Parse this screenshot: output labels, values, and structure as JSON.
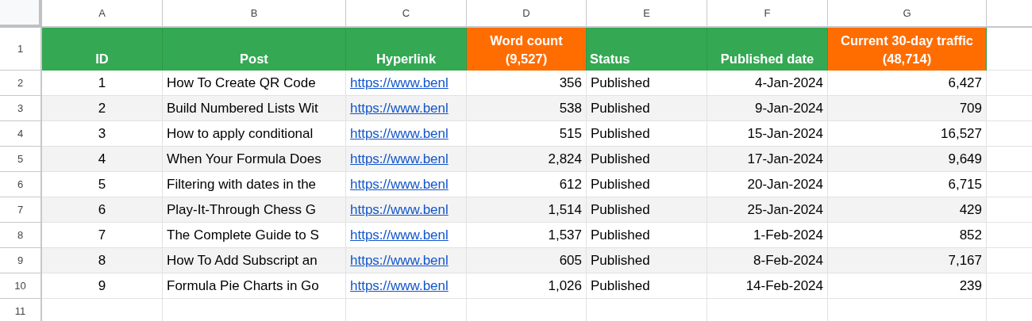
{
  "column_letters": [
    "A",
    "B",
    "C",
    "D",
    "E",
    "F",
    "G"
  ],
  "row_numbers": [
    "1",
    "2",
    "3",
    "4",
    "5",
    "6",
    "7",
    "8",
    "9",
    "10",
    "11"
  ],
  "header": [
    {
      "label": "ID",
      "color": "#34a853"
    },
    {
      "label": "Post",
      "color": "#34a853"
    },
    {
      "label": "Hyperlink",
      "color": "#34a853"
    },
    {
      "label": "Word count (9,527)",
      "color": "#ff6d01"
    },
    {
      "label": "Status",
      "color": "#34a853"
    },
    {
      "label": "Published date",
      "color": "#34a853"
    },
    {
      "label": "Current 30-day traffic (48,714)",
      "color": "#ff6d01"
    }
  ],
  "rows": [
    [
      "1",
      "How To Create QR Code",
      "https://www.benl",
      "356",
      "Published",
      "4-Jan-2024",
      "6,427"
    ],
    [
      "2",
      "Build Numbered Lists Wit",
      "https://www.benl",
      "538",
      "Published",
      "9-Jan-2024",
      "709"
    ],
    [
      "3",
      "How to apply conditional",
      "https://www.benl",
      "515",
      "Published",
      "15-Jan-2024",
      "16,527"
    ],
    [
      "4",
      "When Your Formula Does",
      "https://www.benl",
      "2,824",
      "Published",
      "17-Jan-2024",
      "9,649"
    ],
    [
      "5",
      "Filtering with dates in the",
      "https://www.benl",
      "612",
      "Published",
      "20-Jan-2024",
      "6,715"
    ],
    [
      "6",
      "Play-It-Through Chess G",
      "https://www.benl",
      "1,514",
      "Published",
      "25-Jan-2024",
      "429"
    ],
    [
      "7",
      "The Complete Guide to S",
      "https://www.benl",
      "1,537",
      "Published",
      "1-Feb-2024",
      "852"
    ],
    [
      "8",
      "How To Add Subscript an",
      "https://www.benl",
      "605",
      "Published",
      "8-Feb-2024",
      "7,167"
    ],
    [
      "9",
      "Formula Pie Charts in Go",
      "https://www.benl",
      "1,026",
      "Published",
      "14-Feb-2024",
      "239"
    ]
  ]
}
